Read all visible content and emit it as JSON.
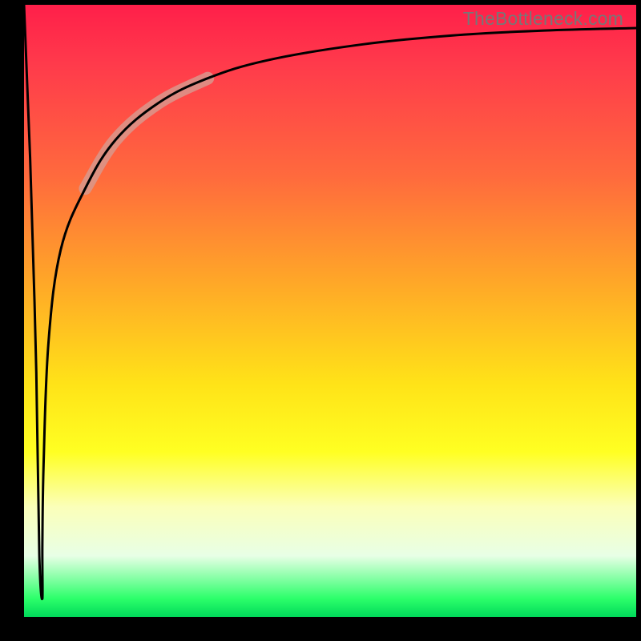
{
  "watermark": "TheBottleneck.com",
  "chart_data": {
    "type": "line",
    "title": "",
    "xlabel": "",
    "ylabel": "",
    "xlim": [
      0,
      100
    ],
    "ylim": [
      0,
      100
    ],
    "grid": false,
    "legend": false,
    "series": [
      {
        "name": "bottleneck-curve",
        "x": [
          0,
          1,
          2,
          2.5,
          3,
          3,
          3.2,
          4,
          6,
          10,
          15,
          22,
          30,
          40,
          55,
          70,
          85,
          100
        ],
        "y": [
          100,
          75,
          40,
          10,
          3,
          12,
          25,
          45,
          60,
          70,
          78,
          84,
          88,
          91,
          93.5,
          95,
          95.8,
          96.2
        ]
      }
    ],
    "highlight_segment": {
      "x_start": 15,
      "x_end": 24
    }
  },
  "colors": {
    "gradient_top": "#ff1f4a",
    "gradient_mid": "#ffe318",
    "gradient_bottom": "#00d95a",
    "curve": "#000000",
    "highlight": "#d89a8f",
    "frame": "#000000"
  }
}
